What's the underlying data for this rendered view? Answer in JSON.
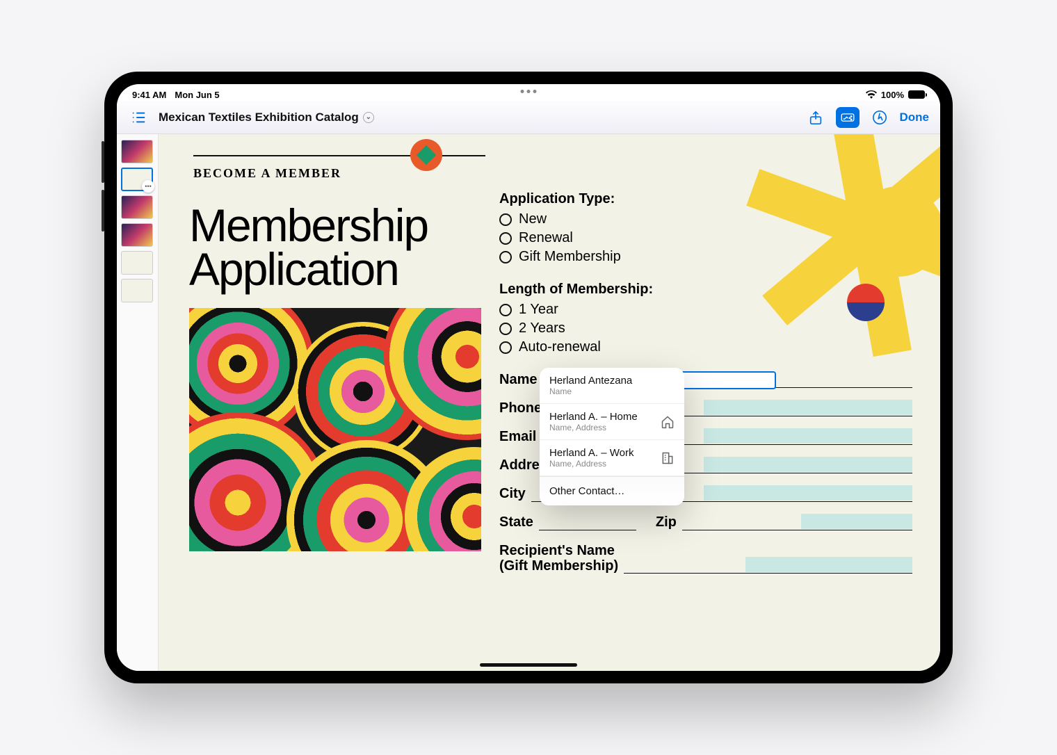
{
  "status": {
    "time": "9:41 AM",
    "date": "Mon Jun 5",
    "battery": "100%"
  },
  "toolbar": {
    "doc_title": "Mexican Textiles Exhibition Catalog",
    "done": "Done"
  },
  "page": {
    "eyebrow": "BECOME A MEMBER",
    "title_1": "Membership",
    "title_2": "Application",
    "app_type_head": "Application Type:",
    "app_type_opts": [
      "New",
      "Renewal",
      "Gift Membership"
    ],
    "length_head": "Length of Membership:",
    "length_opts": [
      "1 Year",
      "2 Years",
      "Auto-renewal"
    ],
    "fields": {
      "name": "Name",
      "phone": "Phone",
      "email": "Email",
      "address": "Address",
      "city": "City",
      "state": "State",
      "zip": "Zip",
      "recipient_1": "Recipient's Name",
      "recipient_2": "(Gift Membership)"
    }
  },
  "autofill": {
    "items": [
      {
        "name": "Herland Antezana",
        "sub": "Name",
        "icon": ""
      },
      {
        "name": "Herland A. – Home",
        "sub": "Name, Address",
        "icon": "home"
      },
      {
        "name": "Herland A. – Work",
        "sub": "Name, Address",
        "icon": "building"
      }
    ],
    "other": "Other Contact…"
  }
}
